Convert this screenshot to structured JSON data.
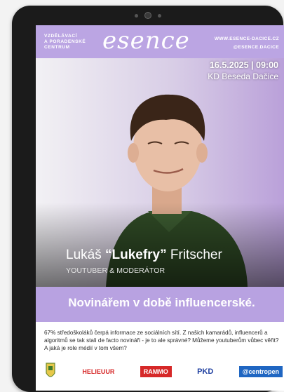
{
  "header": {
    "org_lines": [
      "VZDĚLÁVACÍ",
      "A PORADENSKÉ",
      "CENTRUM"
    ],
    "logo": "esence",
    "website": "WWW.ESENCE-DACICE.CZ",
    "social": "@ESENCE.DACICE",
    "brand_color": "#bba5e3"
  },
  "event": {
    "datetime": "16.5.2025 | 09:00",
    "venue": "KD Beseda Dačice"
  },
  "guest": {
    "first_name": "Lukáš",
    "nickname": "“Lukefry”",
    "last_name": "Fritscher",
    "role": "YOUTUBER & MODERÁTOR"
  },
  "banner": {
    "title": "Novinářem v době influencerské."
  },
  "description": "67% středoškoláků čerpá informace ze sociálních sítí. Z našich kamarádů, influencerů a algoritmů se tak stali de facto novináři - je to ale správné? Můžeme youtuberům vůbec věřit? A jaká je role médií v tom všem?",
  "sponsors": [
    {
      "name": "HELIEUUR",
      "icon": "heliceur-logo"
    },
    {
      "name": "RAMMO",
      "icon": "rammo-logo"
    },
    {
      "name": "PKD",
      "icon": "pkd-logo"
    },
    {
      "name": "@centropen",
      "icon": "centropen-logo"
    }
  ]
}
